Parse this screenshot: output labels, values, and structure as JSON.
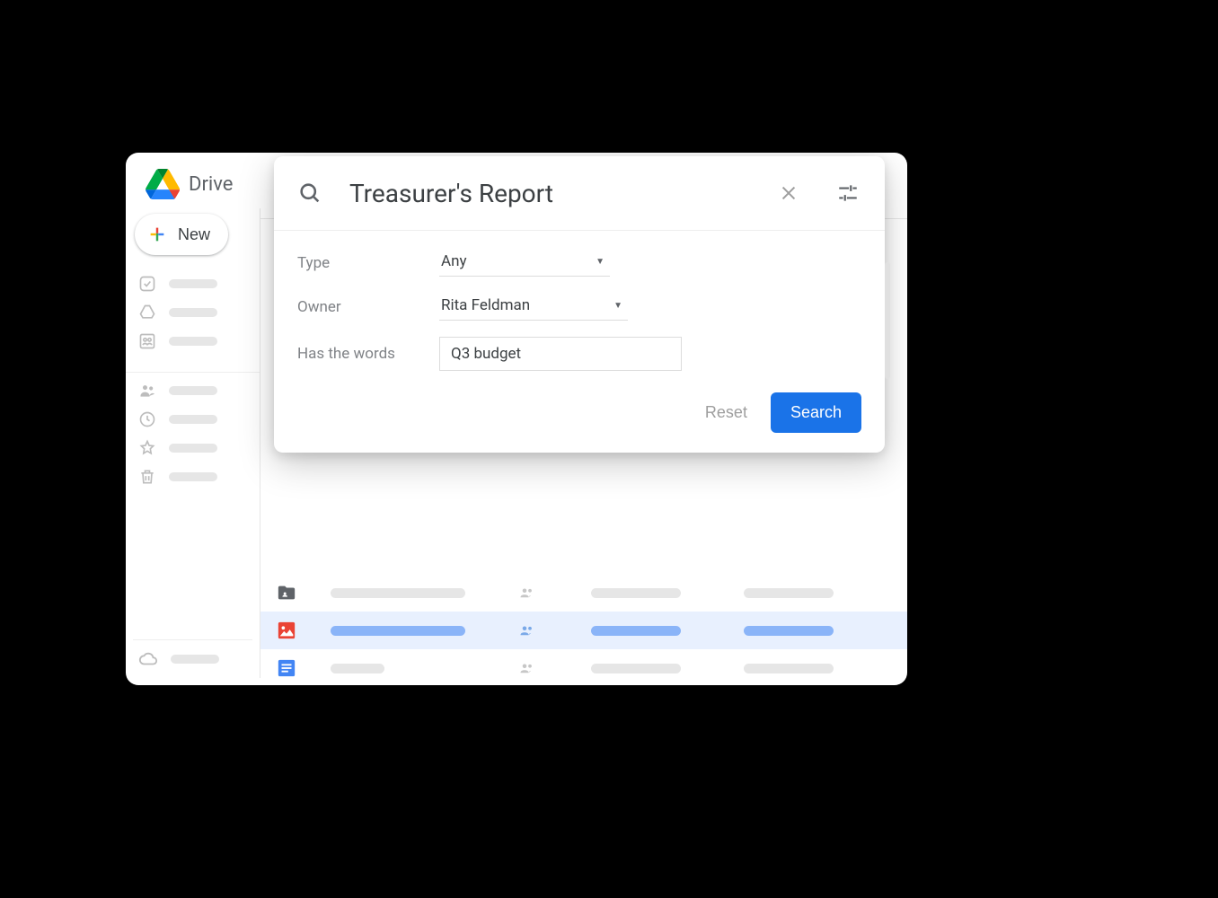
{
  "product": {
    "name": "Drive"
  },
  "sidebar": {
    "new_label": "New"
  },
  "search": {
    "query": "Treasurer's Report",
    "filters": {
      "type_label": "Type",
      "type_value": "Any",
      "owner_label": "Owner",
      "owner_value": "Rita Feldman",
      "words_label": "Has the words",
      "words_value": "Q3 budget"
    },
    "actions": {
      "reset": "Reset",
      "search": "Search"
    }
  }
}
